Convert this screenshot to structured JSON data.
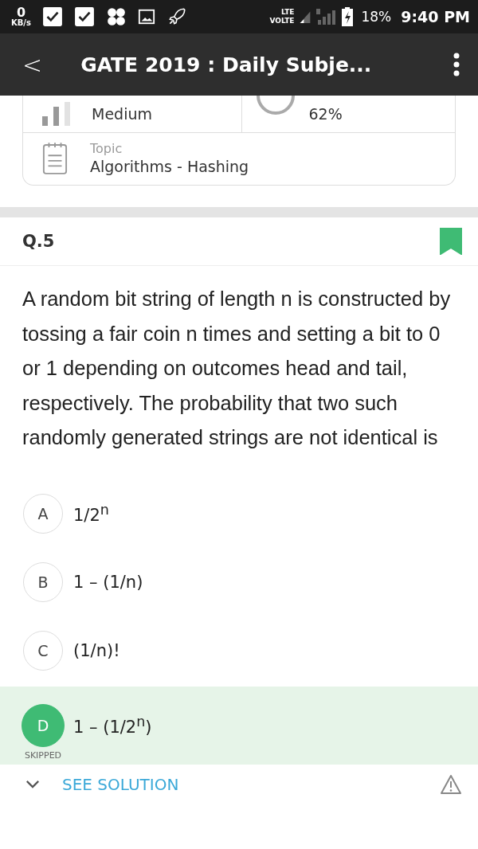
{
  "status_bar": {
    "speed_value": "0",
    "speed_unit": "KB/s",
    "network_top": "LTE",
    "network_bottom": "VOLTE",
    "battery": "18%",
    "time": "9:40 PM"
  },
  "app_bar": {
    "back": "<",
    "title": "GATE 2019 : Daily Subje..."
  },
  "info_card": {
    "difficulty": "Medium",
    "correct_attempts": "62%",
    "topic_label": "Topic",
    "topic": "Algorithms - Hashing"
  },
  "question": {
    "number": "Q.5",
    "bookmarked": true,
    "text": "A random bit string of length n is constructed by tossing a fair coin n times and setting a bit to 0 or 1 depending on outcomes head and tail, respectively. The probability that two such randomly generated strings are not identical is"
  },
  "options": [
    {
      "letter": "A",
      "text": "1/2$^{n}$",
      "selected": false
    },
    {
      "letter": "B",
      "text": "1 – (1/n)",
      "selected": false
    },
    {
      "letter": "C",
      "text": "(1/n)!",
      "selected": false
    },
    {
      "letter": "D",
      "text": "1 – (1/2$^{n}$)",
      "selected": true,
      "status": "SKIPPED"
    }
  ],
  "solution": {
    "label": "SEE SOLUTION",
    "expanded": false
  }
}
